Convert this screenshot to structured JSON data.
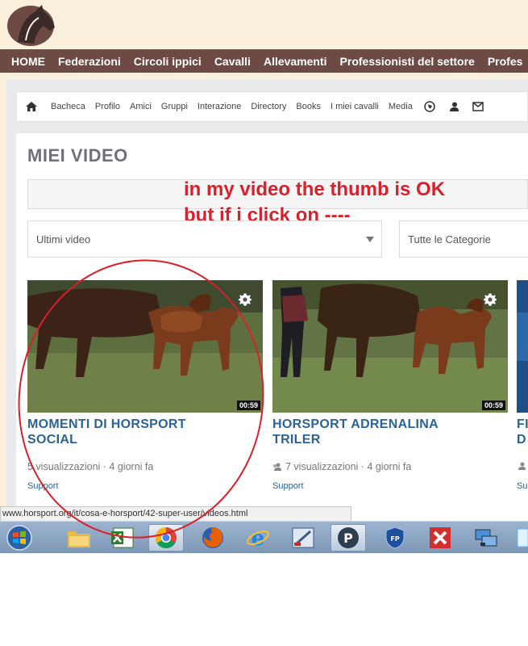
{
  "main_nav": [
    "HOME",
    "Federazioni",
    "Circoli ippici",
    "Cavalli",
    "Allevamenti",
    "Professionisti del settore",
    "Profes"
  ],
  "sub_nav": [
    "Bacheca",
    "Profilo",
    "Amici",
    "Gruppi",
    "Interazione",
    "Directory",
    "Books",
    "I miei cavalli",
    "Media"
  ],
  "page_title": "MIEI VIDEO",
  "annotation": {
    "line1": "in my video the thumb is OK",
    "line2": "but if i click on ----"
  },
  "filters": {
    "sort": "Ultimi video",
    "category": "Tutte le Categorie"
  },
  "videos": [
    {
      "title_line1": "MOMENTI DI HORSPORT",
      "title_line2": "SOCIAL",
      "views": "5 visualizzazioni · 4 giorni fa",
      "category": "Support",
      "duration": "00:59"
    },
    {
      "title_line1": "HORSPORT ADRENALINA",
      "title_line2": "TRILER",
      "views": "7 visualizzazioni · 4 giorni fa",
      "category": "Support",
      "duration": "00:59"
    },
    {
      "title_line1": "FI",
      "title_line2": "D",
      "views": "",
      "category": "Su",
      "duration": ""
    }
  ],
  "status_url": "www.horsport.org/it/cosa-e-horsport/42-super-user/videos.html",
  "taskbar_apps": [
    "windows-start",
    "windows-explorer",
    "excel",
    "chrome",
    "firefox",
    "internet-explorer",
    "drawing-tool",
    "pdf-app",
    "vpn-shield",
    "xmind",
    "network-manager",
    "partial-app"
  ],
  "colors": {
    "nav_bg": "#6e4a44",
    "page_bg": "#faf0dc",
    "link_blue": "#2a6496",
    "annotation_red": "#d9202b",
    "taskbar_bg": "#8ea8c6"
  }
}
